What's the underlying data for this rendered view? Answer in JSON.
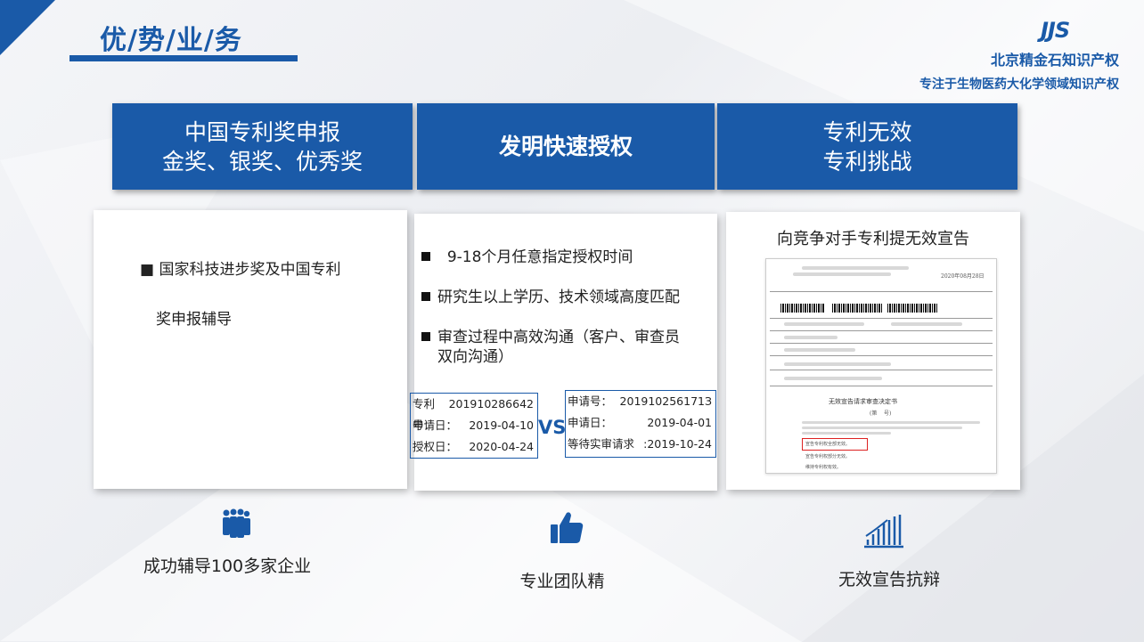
{
  "header": {
    "title": "优/势/业/务",
    "logo": "JJS",
    "company_line1": "北京精金石知识产权",
    "company_line2": "专注于生物医药大化学领域知识产权"
  },
  "columns": [
    {
      "header_lines": [
        "中国专利奖申报",
        "金奖、银奖、优秀奖"
      ],
      "items": [
        "■ 国家科技进步奖及中国专利",
        "奖申报辅导"
      ],
      "footer_icon": "team-people-icon",
      "footer_text": "成功辅导100多家企业"
    },
    {
      "header_lines": [
        "发明快速授权"
      ],
      "items": [
        "9-18个月任意指定授权时间",
        "研究生以上学历、技术领域高度匹配",
        "审查过程中高效沟通（客户、审查员",
        "双向沟通）"
      ],
      "left_box": [
        {
          "label": "专利号：",
          "value": "201910286642"
        },
        {
          "label": "申请日：",
          "value": "2019-04-10"
        },
        {
          "label": "授权日：",
          "value": "2020-04-24"
        }
      ],
      "vs": "VS",
      "right_box": [
        {
          "label": "申请号：",
          "value": "201910256171З"
        },
        {
          "label": "申请日：",
          "value": "2019-04-01"
        },
        {
          "label": "等待实审请求",
          "value": ":2019-10-24"
        }
      ],
      "footer_icon": "thumbs-up-icon",
      "footer_text": "专业团队精"
    },
    {
      "header_lines": [
        "专利无效",
        "专利挑战"
      ],
      "card_title": "向竞争对手专利提无效宣告",
      "doc": {
        "date": "2020年08月28日",
        "heading": "无效宣告请求审查决定书",
        "sub": "(第",
        "sub2": "号)",
        "opt1": "宣告专利权全部无效。",
        "opt2": "宣告专利权部分无效。",
        "opt3": "维持专利权有效。"
      },
      "footer_icon": "bar-chart-icon",
      "footer_text": "无效宣告抗辩"
    }
  ],
  "colors": {
    "brand": "#1a5aa8"
  }
}
